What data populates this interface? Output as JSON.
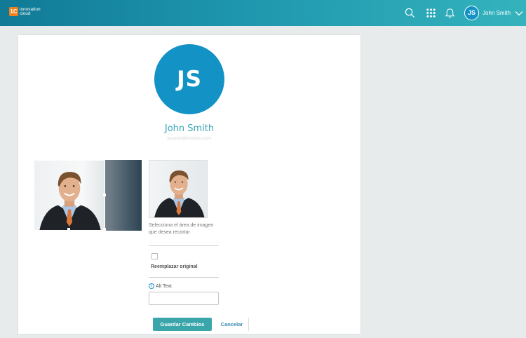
{
  "brand": {
    "mark": "1C",
    "line1": "innovation",
    "line2": "cloud",
    "color": "#f07f1e"
  },
  "topbar": {
    "icons": [
      "search-icon",
      "apps-grid-icon",
      "bell-icon"
    ],
    "user_initials": "JS",
    "user_name": "John Smith"
  },
  "profile": {
    "initials": "JS",
    "name": "John Smith",
    "email": "jsuarez@innosm.com",
    "avatar_color": "#1392c6",
    "name_color": "#3aa6b9"
  },
  "crop": {
    "hint": "Selecciona el área de imagen que desea recortar",
    "replace_label": "Reemplazar original",
    "replace_checked": false,
    "alt_text_label": "Alt Text",
    "alt_text_value": ""
  },
  "actions": {
    "save_label": "Guardar Cambios",
    "cancel_label": "Cancelar",
    "save_color": "#3aa6ac"
  }
}
